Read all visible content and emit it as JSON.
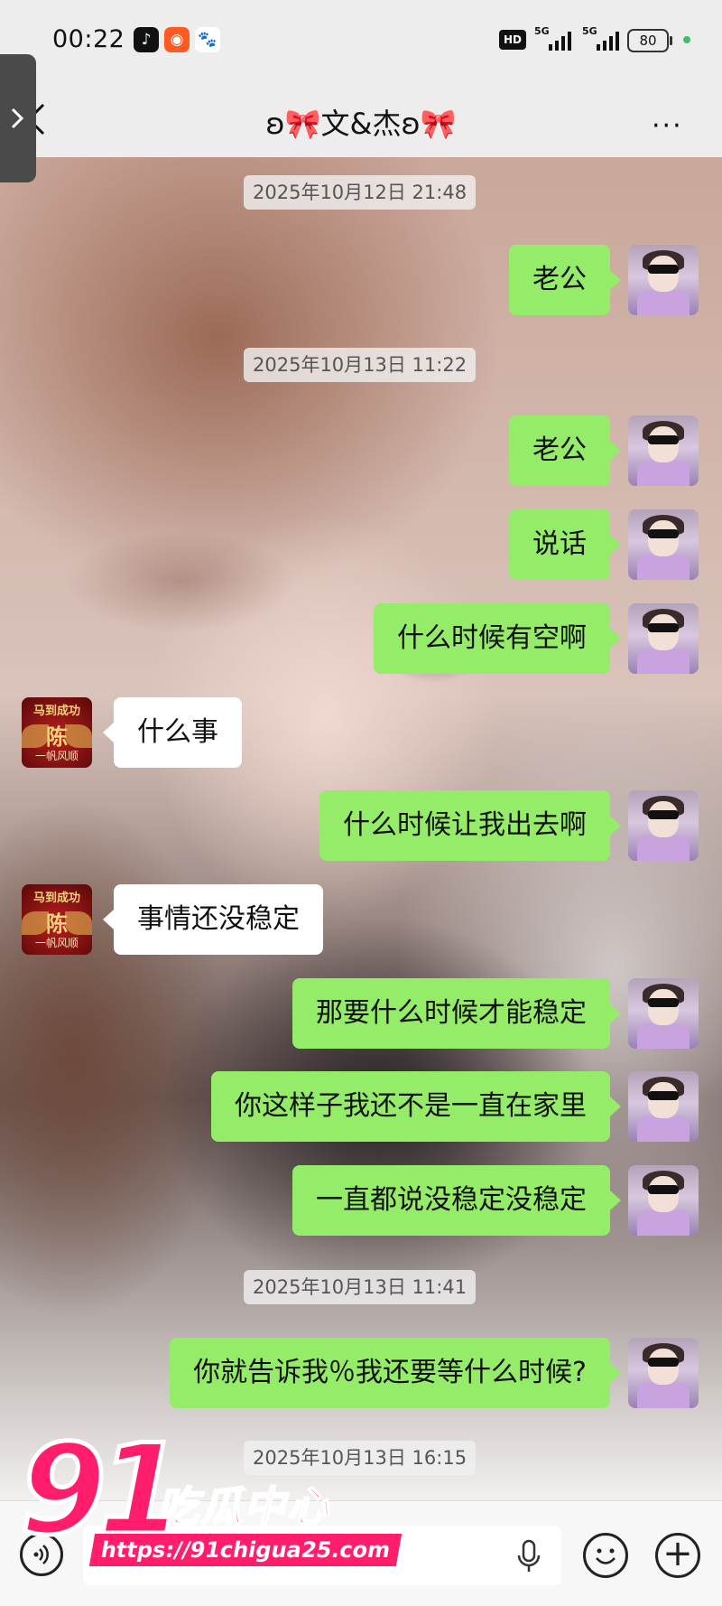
{
  "status_bar": {
    "time": "00:22",
    "app_icons": [
      "douyin-icon",
      "kuaishou-icon",
      "baidu-icon"
    ],
    "hd_badge": "HD",
    "signal_1_label": "5G",
    "signal_2_label": "5G",
    "battery": "80"
  },
  "header": {
    "title": "ʚ🎀文&杰ʚ🎀",
    "more_label": "···"
  },
  "messages": [
    {
      "type": "time",
      "text": "2025年10月12日 21:48"
    },
    {
      "type": "me",
      "text": "老公"
    },
    {
      "type": "time",
      "text": "2025年10月13日 11:22"
    },
    {
      "type": "me",
      "text": "老公"
    },
    {
      "type": "me",
      "text": "说话"
    },
    {
      "type": "me",
      "text": "什么时候有空啊"
    },
    {
      "type": "other",
      "text": "什么事"
    },
    {
      "type": "me",
      "text": "什么时候让我出去啊"
    },
    {
      "type": "other",
      "text": "事情还没稳定"
    },
    {
      "type": "me",
      "text": "那要什么时候才能稳定"
    },
    {
      "type": "me",
      "text": "你这样子我还不是一直在家里"
    },
    {
      "type": "me",
      "text": "一直都说没稳定没稳定"
    },
    {
      "type": "time",
      "text": "2025年10月13日 11:41"
    },
    {
      "type": "me",
      "text": "你就告诉我％我还要等什么时候?"
    },
    {
      "type": "time",
      "text": "2025年10月13日 16:15"
    }
  ],
  "other_avatar": {
    "line1": "马到成功",
    "line2": "陈",
    "line3": "一帆风顺"
  },
  "bottom_bar": {
    "voice_icon": "voice-icon",
    "mic_icon": "mic-icon",
    "emoji_icon": "emoji-icon",
    "plus_label": "+"
  },
  "watermark": {
    "number": "91",
    "name": "吃瓜中心",
    "url": "https://91chigua25.com"
  },
  "colors": {
    "my_bubble": "#95ec69",
    "other_bubble": "#ffffff",
    "watermark": "#ff1d6c"
  }
}
